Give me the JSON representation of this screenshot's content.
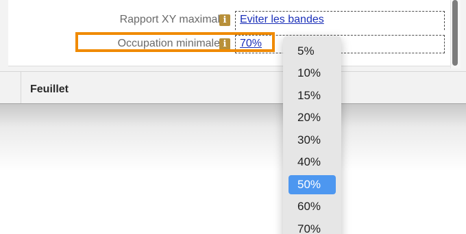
{
  "properties": {
    "rows": [
      {
        "label": "Rapport XY maximal",
        "value": "Eviter les bandes"
      },
      {
        "label": "Occupation minimale",
        "value": "70%"
      }
    ],
    "info_icon_glyph": "i"
  },
  "sheet": {
    "title": "Feuillet"
  },
  "dropdown": {
    "options": [
      "5%",
      "10%",
      "15%",
      "20%",
      "30%",
      "40%",
      "50%",
      "60%",
      "70%"
    ],
    "selected": "50%"
  },
  "colors": {
    "highlight": "#f08a00",
    "selection": "#4d97f0",
    "link": "#1a2fb8",
    "info_icon": "#b8903a"
  }
}
